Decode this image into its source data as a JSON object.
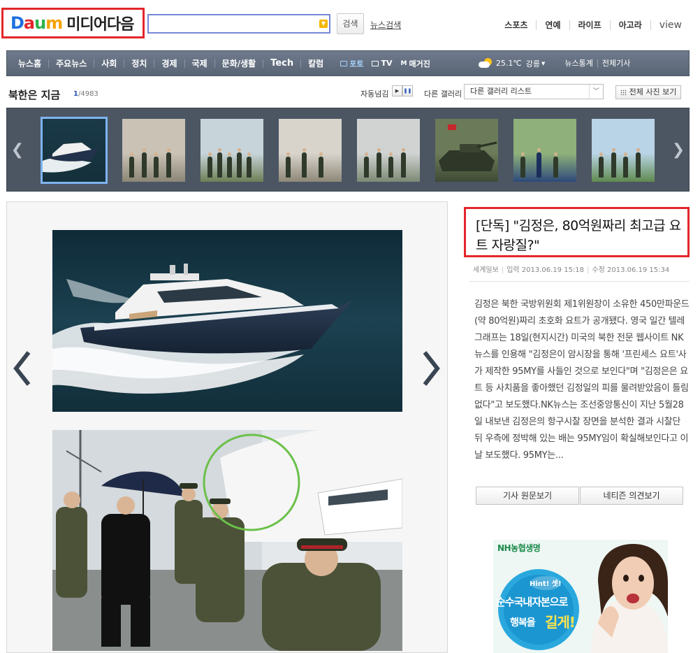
{
  "header": {
    "logo_letters": [
      "D",
      "a",
      "u",
      "m"
    ],
    "logo_colors": [
      "#1e6fe0",
      "#e3262b",
      "#2cb34a",
      "#f5a200"
    ],
    "logo_suffix": "미디어다음",
    "search_placeholder": "",
    "search_button": "검색",
    "news_search": "뉴스검색",
    "top_links": [
      "스포츠",
      "연예",
      "라이프",
      "아고라",
      "view"
    ]
  },
  "nav": {
    "items": [
      "뉴스홈",
      "주요뉴스",
      "사회",
      "정치",
      "경제",
      "국제",
      "문화/생활",
      "Tech",
      "칼럼"
    ],
    "media": [
      {
        "label": "포토",
        "active": true
      },
      {
        "label": "TV",
        "active": false
      },
      {
        "label": "매거진",
        "active": false,
        "prefix": "M"
      }
    ],
    "weather": {
      "temp": "25.1℃",
      "city": "강릉"
    },
    "right_links": [
      "뉴스통계",
      "전체기사"
    ]
  },
  "gallery": {
    "title": "북한은 지금",
    "current": "1",
    "total": "/4983",
    "autoplay_label": "자동넘김",
    "other_gallery_label": "다른 갤러리",
    "select_value": "다른 갤러리 리스트",
    "view_all": "전체 사진 보기",
    "thumbs": [
      {
        "name": "yacht",
        "selected": true
      },
      {
        "name": "soldiers-indoor",
        "selected": false
      },
      {
        "name": "group-outdoor",
        "selected": false
      },
      {
        "name": "group-inspect",
        "selected": false
      },
      {
        "name": "group-indoor",
        "selected": false
      },
      {
        "name": "tank",
        "selected": false
      },
      {
        "name": "waving",
        "selected": false
      },
      {
        "name": "group-road",
        "selected": false
      }
    ]
  },
  "article": {
    "headline": "[단독] \"김정은, 80억원짜리 최고급 요트 자랑질?\"",
    "source": "세계일보",
    "input_time": "입력 2013.06.19 15:18",
    "edit_time": "수정 2013.06.19 15:34",
    "body": "김정은 북한 국방위원회 제1위원장이 소유한 450만파운드(약 80억원)짜리 초호화 요트가 공개됐다. 영국 일간 텔레그래프는 18일(현지시간) 미국의 북한 전문 웹사이트 NK뉴스를 인용해 \"김정은이 암시장을 통해 '프린세스 요트'사가 제작한 95MY를 사들인 것으로 보인다\"며 \"김정은은 요트 등 사치품을 좋아했던 김정일의 피를 물려받았음이 틀림없다\"고 보도했다.NK뉴스는 조선중앙통신이 지난 5월28일 내보낸 김정은의 항구시찰 장면을 분석한 결과 시찰단 뒤 우측에 정박해 있는 배는 95MY임이 확실해보인다고 이날 보도했다. 95MY는...",
    "btn_original": "기사 원문보기",
    "btn_opinion": "네티즌 의견보기"
  },
  "ad": {
    "brand": "NH농협생명",
    "hint": "Hint! 셋!",
    "line1": "순수국내자본으로",
    "line2a": "행복을",
    "line2b": "길게!"
  },
  "colors": {
    "highlight_border": "#e3262b",
    "nav_bg": "#5f6b7b",
    "strip_bg": "#4c5663",
    "active_media": "#a7d4ff"
  }
}
